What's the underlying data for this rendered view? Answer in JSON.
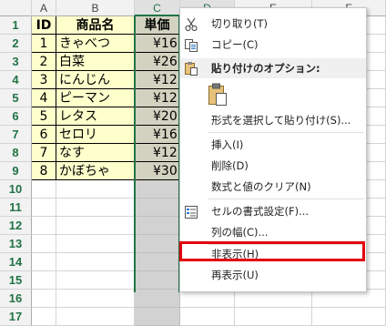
{
  "columns": [
    "A",
    "B",
    "C",
    "D",
    "E",
    "F"
  ],
  "rows": [
    "1",
    "2",
    "3",
    "4",
    "5",
    "6",
    "7",
    "8",
    "9",
    "10",
    "11",
    "12",
    "13",
    "14",
    "15",
    "16",
    "17"
  ],
  "table": {
    "headers": [
      "ID",
      "商品名",
      "単価"
    ],
    "ids": [
      "1",
      "2",
      "3",
      "4",
      "5",
      "6",
      "7",
      "8"
    ],
    "names": [
      "きゃべつ",
      "白菜",
      "にんじん",
      "ピーマン",
      "レタス",
      "セロリ",
      "なす",
      "かぼちゃ"
    ],
    "prices": [
      "¥16",
      "¥26",
      "¥12",
      "¥12",
      "¥20",
      "¥16",
      "¥12",
      "¥30"
    ]
  },
  "menu": {
    "cut": "切り取り(T)",
    "copy": "コピー(C)",
    "paste_options": "貼り付けのオプション:",
    "paste_special": "形式を選択して貼り付け(S)...",
    "insert": "挿入(I)",
    "delete": "削除(D)",
    "clear": "数式と値のクリア(N)",
    "format_cells": "セルの書式設定(F)...",
    "column_width": "列の幅(C)...",
    "hide": "非表示(H)",
    "unhide": "再表示(U)"
  },
  "colors": {
    "accent": "#217346",
    "highlight": "#e3000f",
    "table_fill": "#ffffcc"
  }
}
